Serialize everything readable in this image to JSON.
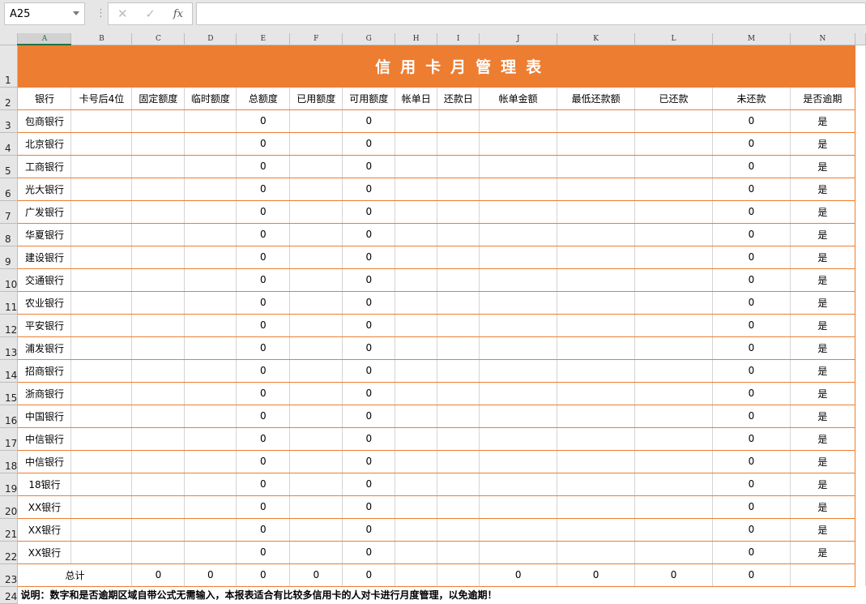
{
  "formula_bar": {
    "name_box": "A25",
    "cancel_icon": "✕",
    "enter_icon": "✓",
    "fx_label": "fx",
    "formula": ""
  },
  "columns": [
    "A",
    "B",
    "C",
    "D",
    "E",
    "F",
    "G",
    "H",
    "I",
    "J",
    "K",
    "L",
    "M",
    "N"
  ],
  "title": "信用卡月管理表",
  "headers": [
    "银行",
    "卡号后4位",
    "固定额度",
    "临时额度",
    "总额度",
    "已用额度",
    "可用额度",
    "帐单日",
    "还款日",
    "帐单金额",
    "最低还款额",
    "已还款",
    "未还款",
    "是否逾期"
  ],
  "banks": [
    "包商银行",
    "北京银行",
    "工商银行",
    "光大银行",
    "广发银行",
    "华夏银行",
    "建设银行",
    "交通银行",
    "农业银行",
    "平安银行",
    "浦发银行",
    "招商银行",
    "浙商银行",
    "中国银行",
    "中信银行",
    "中信银行",
    "18银行",
    "XX银行",
    "XX银行",
    "XX银行"
  ],
  "row_values": {
    "total_limit": "0",
    "available": "0",
    "unpaid": "0",
    "overdue": "是"
  },
  "total_row": {
    "label": "总计",
    "C": "0",
    "D": "0",
    "E": "0",
    "F": "0",
    "G": "0",
    "H": "",
    "I": "",
    "J": "0",
    "K": "0",
    "L": "0",
    "M": "0",
    "N": ""
  },
  "note": "说明：数字和是否逾期区域自带公式无需输入，本报表适合有比较多信用卡的人对卡进行月度管理，以免逾期！"
}
